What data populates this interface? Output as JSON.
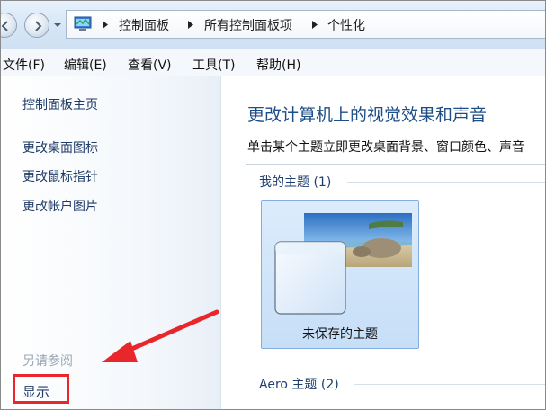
{
  "breadcrumb": {
    "items": [
      "控制面板",
      "所有控制面板项",
      "个性化"
    ]
  },
  "menu": {
    "items": [
      "文件(F)",
      "编辑(E)",
      "查看(V)",
      "工具(T)",
      "帮助(H)"
    ]
  },
  "sidebar": {
    "home": "控制面板主页",
    "links": [
      "更改桌面图标",
      "更改鼠标指针",
      "更改帐户图片"
    ],
    "see_also_label": "另请参阅",
    "display_link": "显示"
  },
  "main": {
    "title": "更改计算机上的视觉效果和声音",
    "description": "单击某个主题立即更改桌面背景、窗口颜色、声音",
    "my_themes_header": "我的主题 (1)",
    "unsaved_theme_label": "未保存的主题",
    "aero_header": "Aero 主题 (2)"
  },
  "colors": {
    "link": "#1f3b66",
    "title": "#1e4e86",
    "annotation_red": "#e8262b",
    "tile_selected": "#c6def7"
  },
  "icons": [
    "back-arrow-icon",
    "forward-arrow-icon",
    "control-panel-icon",
    "chevron-right-icon",
    "red-pointer-arrow"
  ]
}
